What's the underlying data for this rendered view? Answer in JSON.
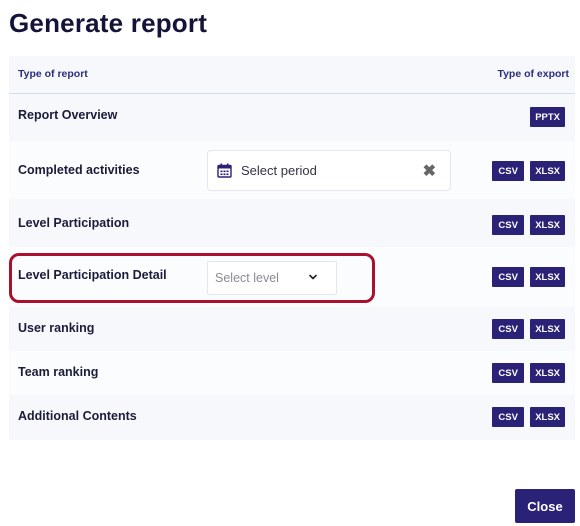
{
  "dialog": {
    "title": "Generate report",
    "close_label": "Close"
  },
  "table": {
    "header_type": "Type of report",
    "header_export": "Type of export",
    "rows": [
      {
        "label": "Report Overview",
        "exports": [
          "PPTX"
        ]
      },
      {
        "label": "Completed activities",
        "exports": [
          "CSV",
          "XLSX"
        ],
        "period_placeholder": "Select period"
      },
      {
        "label": "Level Participation",
        "exports": [
          "CSV",
          "XLSX"
        ]
      },
      {
        "label": "Level Participation Detail",
        "exports": [
          "CSV",
          "XLSX"
        ],
        "level_placeholder": "Select level"
      },
      {
        "label": "User ranking",
        "exports": [
          "CSV",
          "XLSX"
        ]
      },
      {
        "label": "Team ranking",
        "exports": [
          "CSV",
          "XLSX"
        ]
      },
      {
        "label": "Additional Contents",
        "exports": [
          "CSV",
          "XLSX"
        ]
      }
    ]
  },
  "icons": {
    "calendar": "calendar-icon",
    "clear": "close-icon",
    "dropdown": "chevron-down-icon"
  },
  "colors": {
    "primary": "#2a2276",
    "highlight": "#a8102c",
    "title": "#14143a"
  }
}
